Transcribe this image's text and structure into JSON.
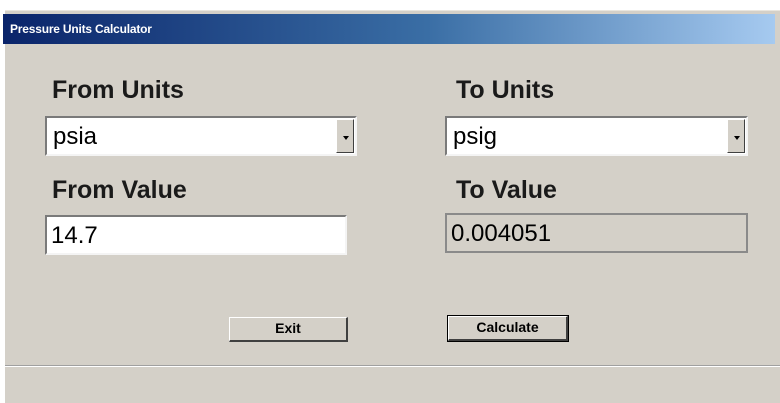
{
  "window": {
    "title": "Pressure Units Calculator"
  },
  "from_units": {
    "label": "From Units",
    "selected": "psia",
    "dropdown_icon": "chevron-down-icon"
  },
  "to_units": {
    "label": "To Units",
    "selected": "psig",
    "dropdown_icon": "chevron-down-icon"
  },
  "from_value": {
    "label": "From Value",
    "value": "14.7"
  },
  "to_value": {
    "label": "To Value",
    "value": "0.004051"
  },
  "buttons": {
    "exit_label": "Exit",
    "calculate_label": "Calculate"
  },
  "colors": {
    "window_bg": "#d4d0c8",
    "title_start": "#0a246a",
    "title_end": "#a6caf0"
  }
}
